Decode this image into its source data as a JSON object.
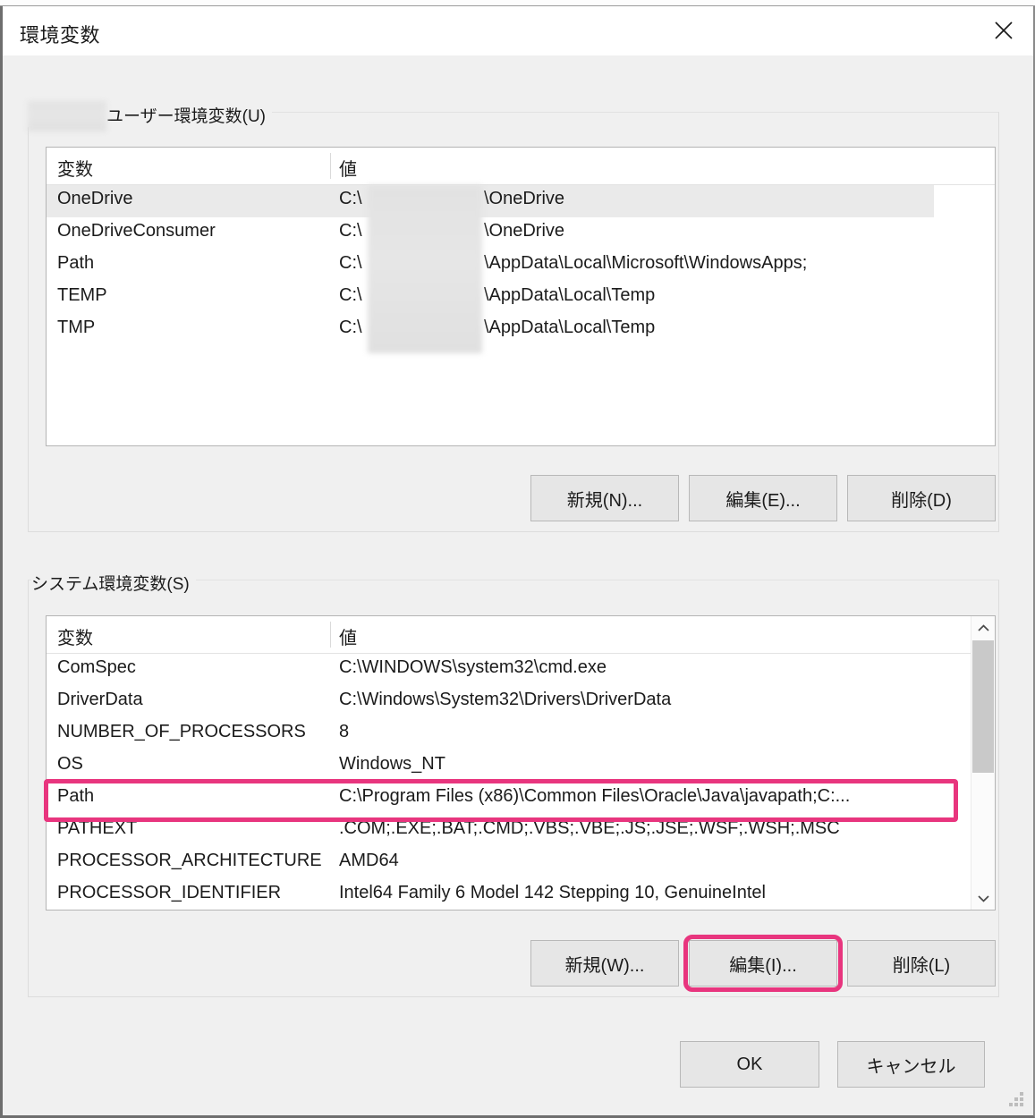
{
  "window": {
    "title": "環境変数",
    "close_icon": "close-icon"
  },
  "user_section": {
    "label": "ユーザー環境変数(U)",
    "columns": [
      "変数",
      "値"
    ],
    "rows": [
      {
        "name": "OneDrive",
        "value_prefix": "C:\\",
        "value_suffix": "\\OneDrive",
        "selected": true
      },
      {
        "name": "OneDriveConsumer",
        "value_prefix": "C:\\",
        "value_suffix": "\\OneDrive",
        "selected": false
      },
      {
        "name": "Path",
        "value_prefix": "C:\\",
        "value_suffix": "\\AppData\\Local\\Microsoft\\WindowsApps;",
        "selected": false
      },
      {
        "name": "TEMP",
        "value_prefix": "C:\\",
        "value_suffix": "\\AppData\\Local\\Temp",
        "selected": false
      },
      {
        "name": "TMP",
        "value_prefix": "C:\\",
        "value_suffix": "\\AppData\\Local\\Temp",
        "selected": false
      }
    ],
    "buttons": {
      "new": "新規(N)...",
      "edit": "編集(E)...",
      "delete": "削除(D)"
    }
  },
  "system_section": {
    "label": "システム環境変数(S)",
    "columns": [
      "変数",
      "値"
    ],
    "rows": [
      {
        "name": "ComSpec",
        "value": "C:\\WINDOWS\\system32\\cmd.exe",
        "highlighted": false
      },
      {
        "name": "DriverData",
        "value": "C:\\Windows\\System32\\Drivers\\DriverData",
        "highlighted": false
      },
      {
        "name": "NUMBER_OF_PROCESSORS",
        "value": "8",
        "highlighted": false
      },
      {
        "name": "OS",
        "value": "Windows_NT",
        "highlighted": false
      },
      {
        "name": "Path",
        "value": "C:\\Program Files (x86)\\Common Files\\Oracle\\Java\\javapath;C:...",
        "highlighted": true
      },
      {
        "name": "PATHEXT",
        "value": ".COM;.EXE;.BAT;.CMD;.VBS;.VBE;.JS;.JSE;.WSF;.WSH;.MSC",
        "highlighted": false
      },
      {
        "name": "PROCESSOR_ARCHITECTURE",
        "value": "AMD64",
        "highlighted": false
      },
      {
        "name": "PROCESSOR_IDENTIFIER",
        "value": "Intel64 Family 6 Model 142 Stepping 10, GenuineIntel",
        "highlighted": false
      }
    ],
    "buttons": {
      "new": "新規(W)...",
      "edit": "編集(I)...",
      "delete": "削除(L)"
    },
    "scrollbar": {
      "up_icon": "chevron-up-icon",
      "down_icon": "chevron-down-icon"
    }
  },
  "dialog_buttons": {
    "ok": "OK",
    "cancel": "キャンセル"
  },
  "annotation": {
    "highlight_color": "#e8357e",
    "highlighted_items": [
      "system-path-row",
      "system-edit-button"
    ]
  }
}
